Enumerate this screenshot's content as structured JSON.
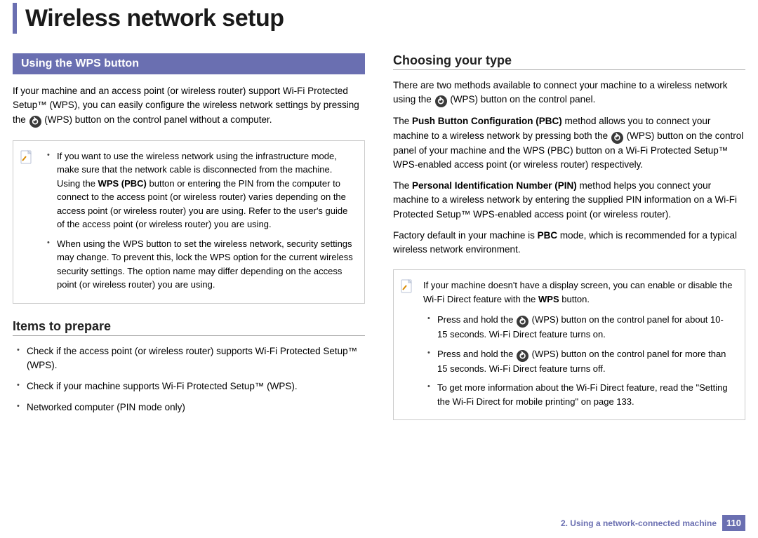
{
  "page_title": "Wireless network setup",
  "left": {
    "section_heading": "Using the WPS button",
    "intro_before": "If your machine and an access point (or wireless router) support Wi-Fi Protected Setup™ (WPS), you can easily configure the wireless network settings by pressing the ",
    "intro_after": " (WPS) button on the control panel without a computer.",
    "note1_a_before": "If you want to use the wireless network using the infrastructure mode, make sure that the network cable is disconnected from the machine. Using the ",
    "note1_a_bold": "WPS (PBC)",
    "note1_a_after": " button or entering the PIN from the computer to connect to the access point (or wireless router) varies depending on the access point (or wireless router) you are using. Refer to the user's guide of the access point (or wireless router) you are using.",
    "note1_b": "When using the WPS button to set the wireless network, security settings may change. To prevent this, lock the WPS option for the current wireless security settings. The option name may differ depending on the access point (or wireless router) you are using.",
    "items_heading": "Items to prepare",
    "item1": "Check if the access point (or wireless router) supports Wi-Fi Protected Setup™ (WPS).",
    "item2": "Check if your machine supports Wi-Fi Protected Setup™ (WPS).",
    "item3": "Networked computer (PIN mode only)"
  },
  "right": {
    "choosing_heading": "Choosing your type",
    "p1_before": "There are two methods available to connect your machine to a wireless network using the ",
    "p1_after": " (WPS) button on the control panel.",
    "p2_before": "The ",
    "p2_bold": "Push Button Configuration (PBC)",
    "p2_mid": " method allows you to connect your machine to a wireless network by pressing both the ",
    "p2_after": " (WPS) button on the control panel of your machine and the WPS (PBC) button on a Wi-Fi Protected Setup™ WPS-enabled access point (or wireless router) respectively.",
    "p3_before": "The ",
    "p3_bold": "Personal Identification Number (PIN)",
    "p3_after": " method helps you connect your machine to a wireless network by entering the supplied PIN information on a Wi-Fi Protected Setup™ WPS-enabled access point (or wireless router).",
    "p4_before": "Factory default in your machine is ",
    "p4_bold": "PBC",
    "p4_after": " mode, which is recommended for a typical wireless network environment.",
    "note2_intro_before": "If your machine doesn't have a display screen, you can enable or disable the Wi-Fi Direct feature with the ",
    "note2_intro_bold": "WPS",
    "note2_intro_after": " button.",
    "note2_b1_before": "Press and hold the ",
    "note2_b1_after": " (WPS) button on the control panel for about 10-15 seconds. Wi-Fi Direct feature turns on.",
    "note2_b2_before": "Press and hold the ",
    "note2_b2_after": " (WPS) button on the control panel for more than 15 seconds. Wi-Fi Direct feature turns off.",
    "note2_b3": "To get more information about the Wi-Fi Direct feature, read the \"Setting the Wi-Fi Direct for mobile printing\" on page 133."
  },
  "footer": {
    "chapter": "2.  Using a network-connected machine",
    "page": "110"
  }
}
